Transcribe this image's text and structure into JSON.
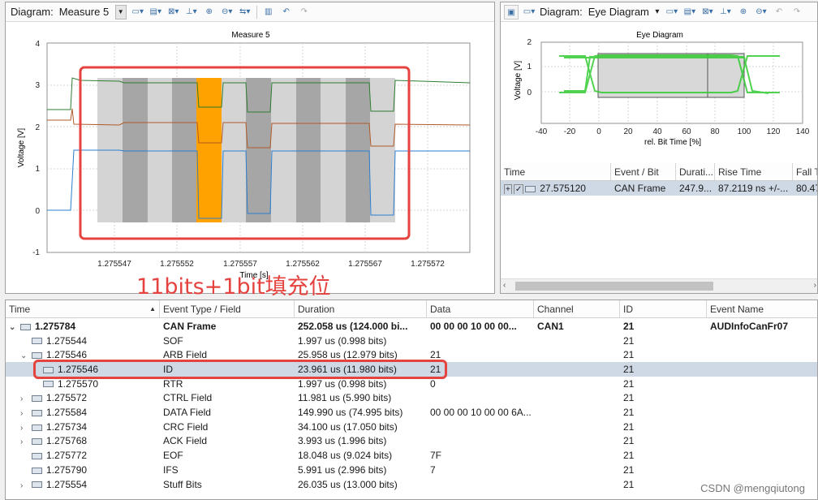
{
  "measure": {
    "toolbar": {
      "label": "Diagram:",
      "selected": "Measure 5"
    },
    "plot": {
      "title": "Measure 5",
      "ylabel": "Voltage [V]",
      "xlabel": "Time [s]",
      "y_ticks": [
        "4",
        "3",
        "2",
        "1",
        "0",
        "-1"
      ],
      "x_ticks": [
        "1.275547",
        "1.275552",
        "1.275557",
        "1.275562",
        "1.275567",
        "1.275572"
      ]
    }
  },
  "eye": {
    "toolbar": {
      "label": "Diagram:",
      "selected": "Eye Diagram"
    },
    "plot": {
      "title": "Eye Diagram",
      "ylabel": "Voltage [V]",
      "xlabel": "rel. Bit Time [%]",
      "y_ticks": [
        "2",
        "1",
        "0"
      ],
      "x_ticks": [
        "-40",
        "-20",
        "0",
        "20",
        "40",
        "60",
        "80",
        "100",
        "120",
        "140"
      ]
    },
    "table": {
      "headers": [
        "Time",
        "Event / Bit",
        "Durati...",
        "Rise Time",
        "Fall T"
      ],
      "row": {
        "time": "27.575120",
        "event": "CAN Frame",
        "duration": "247.9...",
        "rise": "87.2119 ns +/-...",
        "fall": "80.47"
      }
    }
  },
  "annotation": "11bits+1bit填充位",
  "events": {
    "headers": [
      "Time",
      "Event Type / Field",
      "Duration",
      "Data",
      "Channel",
      "ID",
      "Event Name"
    ],
    "rows": [
      {
        "exp": "⌄",
        "time": "1.275784",
        "field": "CAN Frame",
        "duration": "252.058 us (124.000 bi...",
        "data": "00 00 00 10 00 00...",
        "channel": "CAN1",
        "id": "21",
        "name": "AUDInfoCanFr07",
        "bold": true,
        "level": 0
      },
      {
        "exp": "",
        "time": "1.275544",
        "field": "SOF",
        "duration": "1.997 us (0.998 bits)",
        "data": "",
        "channel": "",
        "id": "21",
        "name": "",
        "level": 1
      },
      {
        "exp": "⌄",
        "time": "1.275546",
        "field": "ARB Field",
        "duration": "25.958 us (12.979 bits)",
        "data": "21",
        "channel": "",
        "id": "21",
        "name": "",
        "level": 1
      },
      {
        "exp": "",
        "time": "1.275546",
        "field": "ID",
        "duration": "23.961 us (11.980 bits)",
        "data": "21",
        "channel": "",
        "id": "21",
        "name": "",
        "level": 2,
        "selected": true
      },
      {
        "exp": "",
        "time": "1.275570",
        "field": "RTR",
        "duration": "1.997 us (0.998 bits)",
        "data": "0",
        "channel": "",
        "id": "21",
        "name": "",
        "level": 2
      },
      {
        "exp": "›",
        "time": "1.275572",
        "field": "CTRL Field",
        "duration": "11.981 us (5.990 bits)",
        "data": "",
        "channel": "",
        "id": "21",
        "name": "",
        "level": 1
      },
      {
        "exp": "›",
        "time": "1.275584",
        "field": "DATA Field",
        "duration": "149.990 us (74.995 bits)",
        "data": "00 00 00 10 00 00 6A...",
        "channel": "",
        "id": "21",
        "name": "",
        "level": 1
      },
      {
        "exp": "›",
        "time": "1.275734",
        "field": "CRC Field",
        "duration": "34.100 us (17.050 bits)",
        "data": "",
        "channel": "",
        "id": "21",
        "name": "",
        "level": 1
      },
      {
        "exp": "›",
        "time": "1.275768",
        "field": "ACK Field",
        "duration": "3.993 us (1.996 bits)",
        "data": "",
        "channel": "",
        "id": "21",
        "name": "",
        "level": 1
      },
      {
        "exp": "",
        "time": "1.275772",
        "field": "EOF",
        "duration": "18.048 us (9.024 bits)",
        "data": "7F",
        "channel": "",
        "id": "21",
        "name": "",
        "level": 1
      },
      {
        "exp": "",
        "time": "1.275790",
        "field": "IFS",
        "duration": "5.991 us (2.996 bits)",
        "data": "7",
        "channel": "",
        "id": "21",
        "name": "",
        "level": 1
      },
      {
        "exp": "›",
        "time": "1.275554",
        "field": "Stuff Bits",
        "duration": "26.035 us (13.000 bits)",
        "data": "",
        "channel": "",
        "id": "21",
        "name": "",
        "level": 1
      }
    ]
  },
  "watermark": "CSDN @mengqiutong",
  "colors": {
    "green": "#2e7d32",
    "brown": "#b05a2a",
    "blue": "#2b7fd0",
    "orange": "#ffa200",
    "annotation": "#e4433f",
    "selected_row": "#cfd9e6"
  }
}
